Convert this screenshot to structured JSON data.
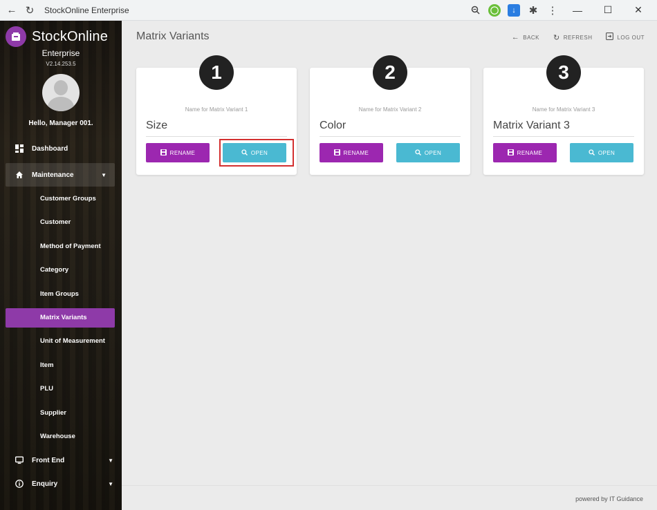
{
  "browser": {
    "tab_title": "StockOnline Enterprise"
  },
  "sidebar": {
    "brand": "StockOnline",
    "edition": "Enterprise",
    "version": "V2.14.253.5",
    "greeting": "Hello, Manager 001.",
    "menu": [
      {
        "label": "Dashboard",
        "icon": "dashboard-icon"
      },
      {
        "label": "Maintenance",
        "icon": "home-icon"
      },
      {
        "label": "Front End",
        "icon": "monitor-icon"
      },
      {
        "label": "Enquiry",
        "icon": "info-icon"
      }
    ],
    "submenu": [
      "Customer Groups",
      "Customer",
      "Method of Payment",
      "Category",
      "Item Groups",
      "Matrix Variants",
      "Unit of Measurement",
      "Item",
      "PLU",
      "Supplier",
      "Warehouse"
    ],
    "active_color": "#8e3aa8"
  },
  "main": {
    "title": "Matrix Variants",
    "actions": {
      "back": "BACK",
      "refresh": "REFRESH",
      "logout": "LOG OUT"
    },
    "cards": [
      {
        "number": "1",
        "label": "Name for Matrix Variant 1",
        "value": "Size",
        "rename": "RENAME",
        "open": "OPEN"
      },
      {
        "number": "2",
        "label": "Name for Matrix Variant 2",
        "value": "Color",
        "rename": "RENAME",
        "open": "OPEN"
      },
      {
        "number": "3",
        "label": "Name for Matrix Variant 3",
        "value": "Matrix Variant 3",
        "rename": "RENAME",
        "open": "OPEN"
      }
    ],
    "footer": "powered by IT Guidance"
  },
  "colors": {
    "rename": "#9c27b0",
    "open": "#4ab9d2",
    "highlight": "#d32f2f"
  }
}
